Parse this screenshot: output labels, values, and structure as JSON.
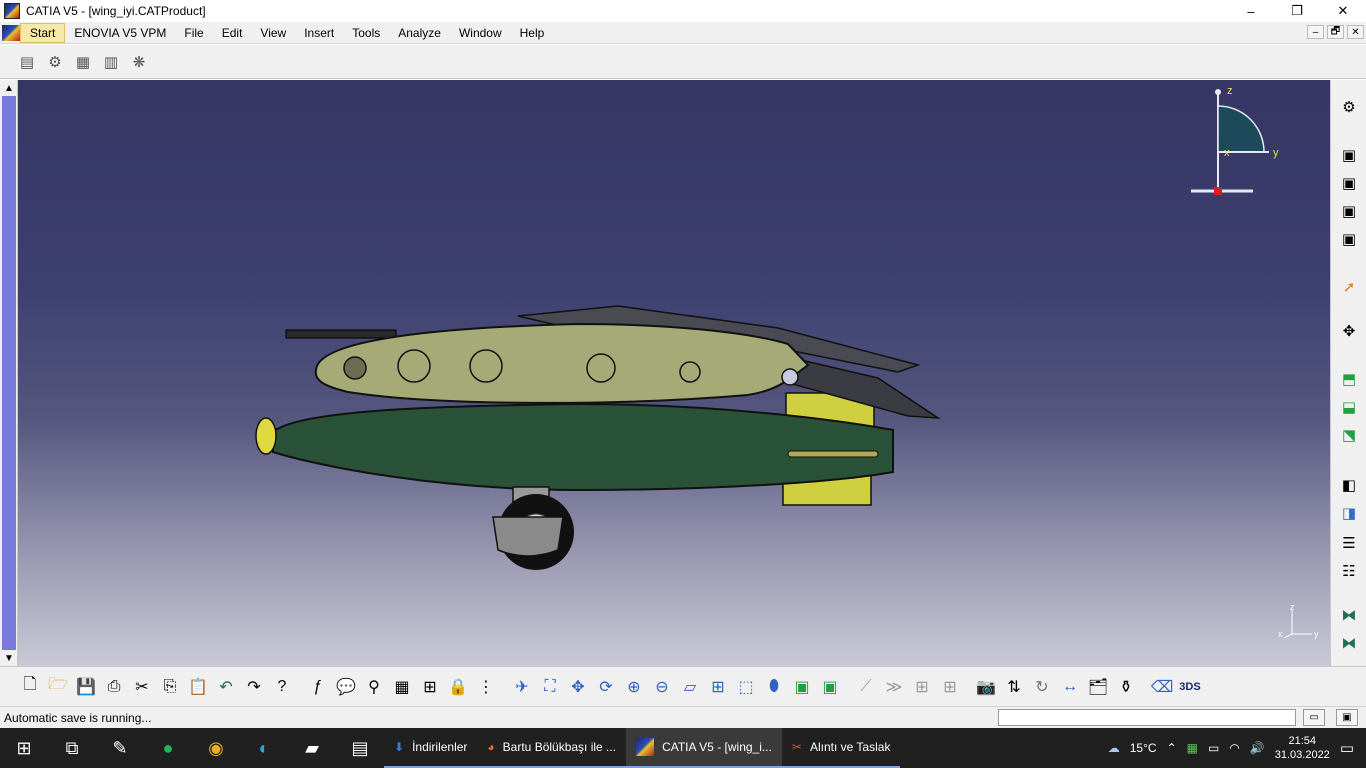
{
  "window": {
    "title": "CATIA V5 - [wing_iyi.CATProduct]",
    "controls": [
      "–",
      "❐",
      "✕"
    ]
  },
  "menu": {
    "items": [
      "Start",
      "ENOVIA V5 VPM",
      "File",
      "Edit",
      "View",
      "Insert",
      "Tools",
      "Analyze",
      "Window",
      "Help"
    ],
    "doc_controls": [
      "–",
      "🗗",
      "✕"
    ]
  },
  "compass": {
    "z": "z",
    "y": "y",
    "x": "x"
  },
  "mini_axis": {
    "z": "z",
    "x": "x",
    "y": "y"
  },
  "status": {
    "text": "Automatic save is running..."
  },
  "taskbar": {
    "apps": [
      {
        "label": "İndirilenler",
        "icon": "downloads-folder-icon"
      },
      {
        "label": "Bartu Bölükbaşı ile ...",
        "icon": "firefox-icon"
      },
      {
        "label": "CATIA V5 - [wing_i...",
        "icon": "catia-icon"
      },
      {
        "label": "Alıntı ve Taslak",
        "icon": "snip-sketch-icon"
      }
    ],
    "weather": "15°C",
    "time": "21:54",
    "date": "31.03.2022"
  },
  "colors": {
    "background_top": "#353663",
    "background_bottom": "#c9c9d6",
    "wing": "#a5aa76",
    "tank": "#2a5238",
    "yellow": "#d0cf40"
  }
}
